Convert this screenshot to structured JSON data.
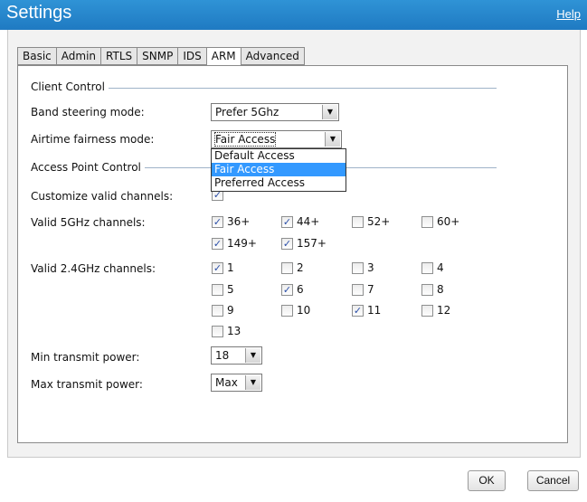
{
  "header": {
    "title": "Settings",
    "help": "Help"
  },
  "tabs": [
    "Basic",
    "Admin",
    "RTLS",
    "SNMP",
    "IDS",
    "ARM",
    "Advanced"
  ],
  "active_tab": "ARM",
  "client_control": {
    "section": "Client Control",
    "band_label": "Band steering mode:",
    "band_value": "Prefer 5Ghz",
    "airtime_label": "Airtime fairness mode:",
    "airtime_value": "Fair Access",
    "airtime_options": [
      "Default Access",
      "Fair Access",
      "Preferred Access"
    ],
    "airtime_selected": "Fair Access"
  },
  "ap_control": {
    "section": "Access Point Control",
    "customize_label": "Customize valid channels:",
    "customize_checked": true,
    "ch5_label": "Valid 5GHz channels:",
    "ch5": [
      {
        "label": "36+",
        "checked": true
      },
      {
        "label": "44+",
        "checked": true
      },
      {
        "label": "52+",
        "checked": false
      },
      {
        "label": "60+",
        "checked": false
      },
      {
        "label": "149+",
        "checked": true
      },
      {
        "label": "157+",
        "checked": true
      }
    ],
    "ch24_label": "Valid 2.4GHz channels:",
    "ch24": [
      {
        "label": "1",
        "checked": true
      },
      {
        "label": "2",
        "checked": false
      },
      {
        "label": "3",
        "checked": false
      },
      {
        "label": "4",
        "checked": false
      },
      {
        "label": "5",
        "checked": false
      },
      {
        "label": "6",
        "checked": true
      },
      {
        "label": "7",
        "checked": false
      },
      {
        "label": "8",
        "checked": false
      },
      {
        "label": "9",
        "checked": false
      },
      {
        "label": "10",
        "checked": false
      },
      {
        "label": "11",
        "checked": true
      },
      {
        "label": "12",
        "checked": false
      },
      {
        "label": "13",
        "checked": false
      }
    ],
    "min_label": "Min transmit power:",
    "min_value": "18",
    "max_label": "Max transmit power:",
    "max_value": "Max"
  },
  "footer": {
    "ok": "OK",
    "cancel": "Cancel"
  },
  "icons": {
    "checkmark": "✓",
    "dropdown": "▼"
  }
}
